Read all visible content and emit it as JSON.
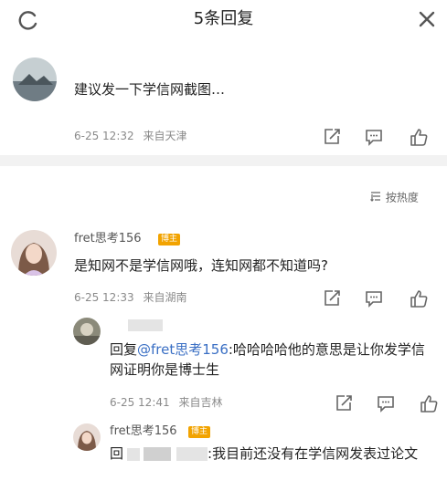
{
  "header": {
    "title": "5条回复",
    "refresh_icon": "refresh-icon",
    "close_icon": "close-icon"
  },
  "comment1": {
    "text": "建议发一下学信网截图…",
    "time": "6-25 12:32",
    "location": "来自天津"
  },
  "sort": {
    "label": "按热度"
  },
  "comment2": {
    "username": "fret思考156",
    "badge": "博主",
    "text": "是知网不是学信网哦，连知网都不知道吗?",
    "time": "6-25 12:33",
    "location": "来自湖南"
  },
  "reply1": {
    "prefix": "回复",
    "mention": "@fret思考156",
    "text": ":哈哈哈哈他的意思是让你发学信网证明你是博士生",
    "time": "6-25 12:41",
    "location": "来自吉林"
  },
  "reply2": {
    "username": "fret思考156",
    "badge": "博主",
    "prefix": "回",
    "text": ":我目前还没有在学信网发表过论文"
  },
  "colors": {
    "badge": "#f2a300",
    "separator": "#f2f2f2",
    "meta": "#8a8a8a"
  }
}
